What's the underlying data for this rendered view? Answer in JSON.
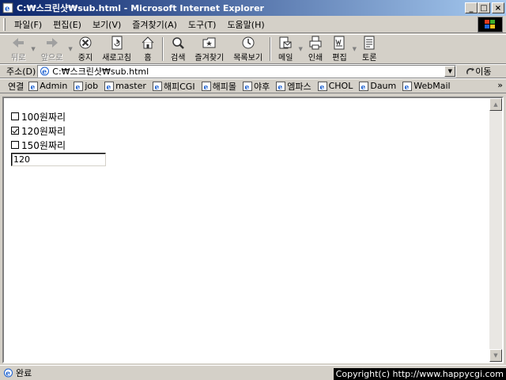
{
  "window": {
    "title": "C:₩스크린샷₩sub.html - Microsoft Internet Explorer",
    "buttons": [
      "_",
      "□",
      "×"
    ]
  },
  "menu": [
    "파일(F)",
    "편집(E)",
    "보기(V)",
    "즐겨찾기(A)",
    "도구(T)",
    "도움말(H)"
  ],
  "toolbar": {
    "back": "뒤로",
    "forward": "앞으로",
    "stop": "중지",
    "refresh": "새로고침",
    "home": "홈",
    "search": "검색",
    "favorites": "즐겨찾기",
    "history": "목록보기",
    "mail": "메일",
    "print": "인쇄",
    "edit": "편집",
    "discuss": "토론"
  },
  "address": {
    "label": "주소(D)",
    "url": "C:₩스크린샷₩sub.html",
    "go": "이동"
  },
  "links": {
    "label": "연결",
    "items": [
      "Admin",
      "job",
      "master",
      "해피CGI",
      "해피몰",
      "야후",
      "엠파스",
      "CHOL",
      "Daum",
      "WebMail"
    ],
    "more": "»"
  },
  "page": {
    "options": [
      {
        "label": "100원짜리",
        "checked": false
      },
      {
        "label": "120원짜리",
        "checked": true
      },
      {
        "label": "150원짜리",
        "checked": false
      }
    ],
    "input_value": "120"
  },
  "status": {
    "text": "완료",
    "watermark": "Copyright(c) http://www.happycgi.com"
  },
  "colors": {
    "titlebar_start": "#0a246a",
    "titlebar_end": "#a6caf0",
    "chrome": "#d4d0c8"
  }
}
